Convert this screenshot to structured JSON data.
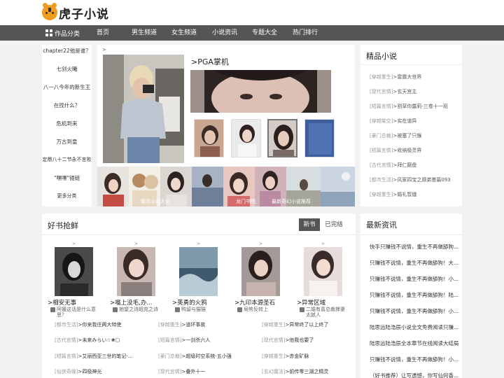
{
  "site": {
    "logo_text": "虎子小说",
    "accent": "#f29c1f",
    "nav_bg": "#555555"
  },
  "nav": {
    "category": "作品分类",
    "items": [
      "首页",
      "男生频道",
      "女生频道",
      "小说资讯",
      "专题大全",
      "热门排行"
    ]
  },
  "sidebar": {
    "items": [
      "chapter22他是谁？",
      "七剑火曦",
      "八一八今年的新生王",
      "在找什么？",
      "危机到来",
      "万古到皇",
      "定鼎八十二节永不言败",
      "\"嘿嘿\"镜链",
      "更多分类"
    ]
  },
  "feature": {
    "arrow": ">",
    "title": ">PGA掌机",
    "strip_captions": [
      "繁花小说大全",
      "龙门书院",
      "最新奇幻小说推荐"
    ]
  },
  "jingpin": {
    "title": "精品小说",
    "items": [
      {
        "genre": "[穿越重生]",
        "name": ">雷霆大世界"
      },
      {
        "genre": "[现代言情]",
        "name": ">玄天宫主"
      },
      {
        "genre": "[短篇言情]",
        "name": ">割草你露莉-三卷十一班"
      },
      {
        "genre": "[穿越架空]",
        "name": ">实在道异"
      },
      {
        "genre": "[豪门总裁]",
        "name": ">被塞了只猴"
      },
      {
        "genre": "[短篇言情]",
        "name": ">收纳极灵界"
      },
      {
        "genre": "[古代言情]",
        "name": ">拜仁巅盘"
      },
      {
        "genre": "[都市生活]",
        "name": ">风家四宝之顾弟墨篇093"
      },
      {
        "genre": "[穿越重生]",
        "name": ">婚礼暂缝"
      }
    ]
  },
  "books": {
    "title": "好书抢鲜",
    "tab_new": "新书",
    "tab_done": "已完结",
    "cards": [
      {
        "caret": ">",
        "name": ">相安无事",
        "author": "阿媛这话是什么意思？"
      },
      {
        "caret": ">",
        "name": ">嘴上没毛,办...",
        "author": "她望之诗超克之诗"
      },
      {
        "caret": ">",
        "name": ">英勇的火鸦",
        "author": "鸭留与猫猫"
      },
      {
        "caret": ">",
        "name": ">九印本源圣石",
        "author": "局势反转上"
      },
      {
        "caret": ">",
        "name": ">异常区域",
        "author": "二婚有喜总裁撑妻太腻人"
      }
    ],
    "list_left": [
      {
        "genre": "[都市生活]",
        "name": ">你来我往两大特使"
      },
      {
        "genre": "[古代言情]",
        "name": ">未来みらい☆❀▢"
      },
      {
        "genre": "[短篇言情]",
        "name": ">艾丽西亚三世的笔记-..."
      },
      {
        "genre": "[仙侠奇缘]",
        "name": ">四极神光"
      }
    ],
    "list_mid": [
      {
        "genre": "[穿越重生]",
        "name": ">道环事故"
      },
      {
        "genre": "[短篇言情]",
        "name": ">一剑杀六人"
      },
      {
        "genre": "[豪门总裁]",
        "name": ">超级时空系统-五小强"
      },
      {
        "genre": "[现代言情]",
        "name": ">叠外十一"
      }
    ],
    "list_right": [
      {
        "genre": "[穿越重生]",
        "name": ">异常终了以上终了"
      },
      {
        "genre": "[现代言情]",
        "name": ">他我也要了"
      },
      {
        "genre": "[穿越重生]",
        "name": ">赤金矿脉"
      },
      {
        "genre": "[玄幻魔法]",
        "name": ">前传零三湖之精灵"
      }
    ]
  },
  "news": {
    "title": "最新资讯",
    "items": [
      "快手只赚钱不说情，重生不再做舔狗...",
      "只赚钱不说情，重生不再做舔狗！大...",
      "只赚钱不说情，重生不再做舔狗！小...",
      "只赚钱不说情，重生不再做舔狗！陆...",
      "只赚钱不说情，重生不再做舔狗！小...",
      "陆思远陆浩辰小说全文免费阅读只赚...",
      "陆思远陆浩辰全本章节在线阅读大结局",
      "只赚钱不说情，重生不再做舔狗！小...",
      "（好书推荐）让写遗憾，你写仙何香...",
      "周游莱天反正也是错过小说全章节最..."
    ]
  }
}
